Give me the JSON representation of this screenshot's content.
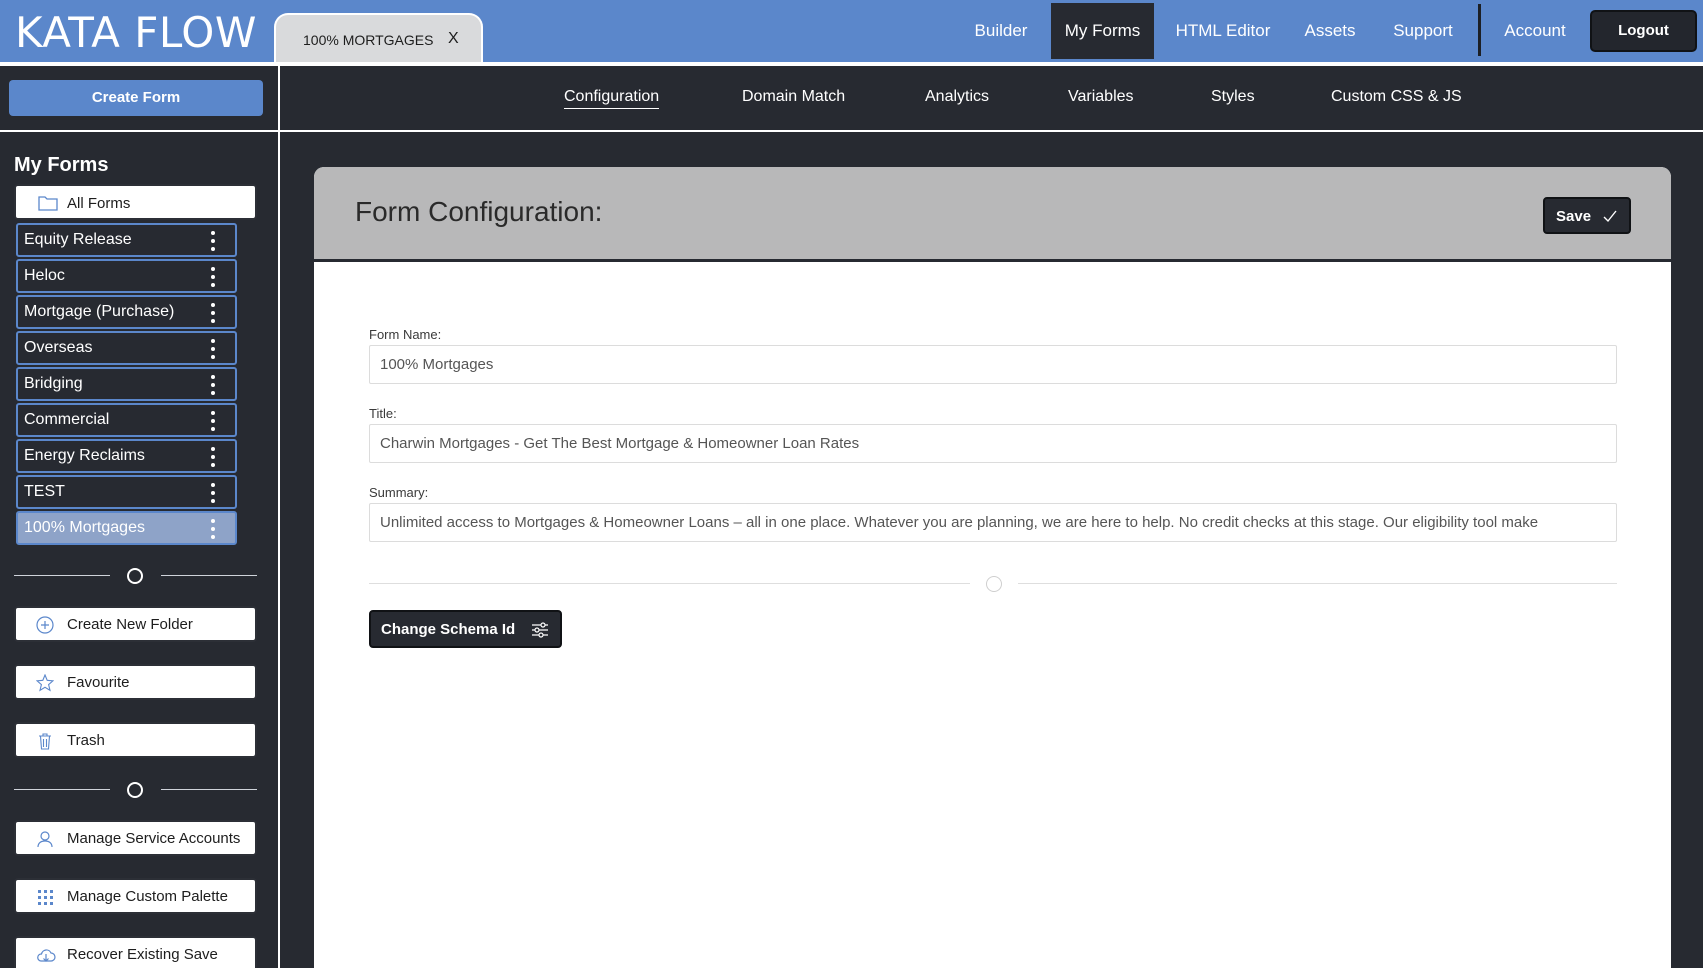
{
  "app": {
    "brand": "KATA FLOW"
  },
  "doc_tab": {
    "title": "100% MORTGAGES",
    "close": "X"
  },
  "topnav": {
    "items": [
      "Builder",
      "My Forms",
      "HTML Editor",
      "Assets",
      "Support",
      "Account"
    ],
    "active": "My Forms",
    "logout": "Logout"
  },
  "sidebar": {
    "create_form": "Create Form",
    "heading": "My Forms",
    "all_forms": "All Forms",
    "forms": [
      "Equity Release",
      "Heloc",
      "Mortgage (Purchase)",
      "Overseas",
      "Bridging",
      "Commercial",
      "Energy Reclaims",
      "TEST",
      "100% Mortgages"
    ],
    "selected_form": "100% Mortgages",
    "actions": {
      "create_folder": "Create New Folder",
      "favourite": "Favourite",
      "trash": "Trash",
      "service_accounts": "Manage Service Accounts",
      "custom_palette": "Manage Custom Palette",
      "recover_save": "Recover Existing Save"
    }
  },
  "subnav": {
    "items": [
      "Configuration",
      "Domain Match",
      "Analytics",
      "Variables",
      "Styles",
      "Custom CSS & JS"
    ],
    "active": "Configuration"
  },
  "config": {
    "title": "Form Configuration:",
    "save": "Save",
    "form_name_label": "Form Name:",
    "form_name_value": "100% Mortgages",
    "title_label": "Title:",
    "title_value": "Charwin Mortgages - Get The Best Mortgage & Homeowner Loan Rates",
    "summary_label": "Summary:",
    "summary_value": "Unlimited access to Mortgages & Homeowner Loans – all in one place. Whatever you are planning, we are here to help. No credit checks at this stage. Our eligibility tool make",
    "change_schema": "Change Schema Id"
  },
  "colors": {
    "topbar": "#5b87cb",
    "dark_bg": "#272a31",
    "card_header": "#b8b8b9",
    "selected_item": "#8ea3c8"
  },
  "icons": {
    "all_forms": "folder-icon",
    "create_folder": "plus-circle-icon",
    "favourite": "star-icon",
    "trash": "trash-icon",
    "service_accounts": "user-icon",
    "custom_palette": "grid-icon",
    "recover_save": "cloud-icon",
    "save": "check-icon",
    "schema": "sliders-icon",
    "form_menu": "kebab-menu-icon"
  }
}
